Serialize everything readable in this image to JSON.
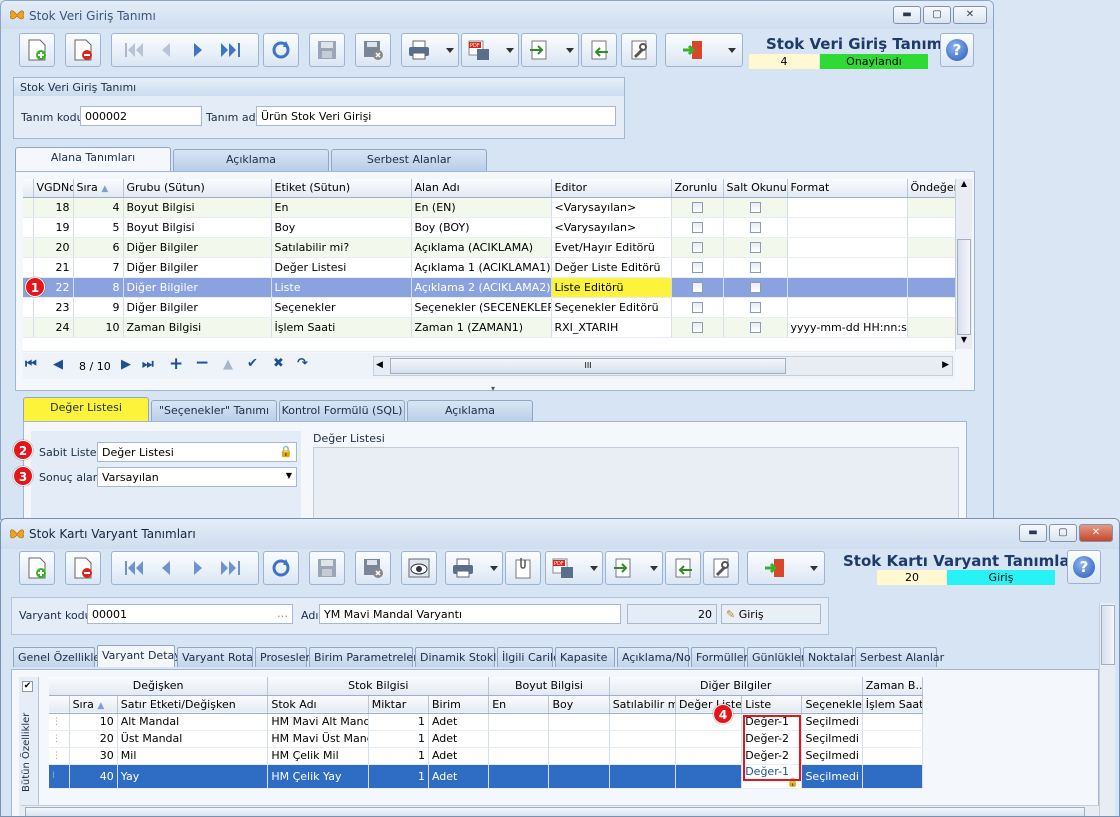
{
  "colors": {
    "accent": "#1d3a6a",
    "status_green": "#2edb32",
    "status_cyan": "#27f2f6",
    "highlight_yellow": "#fdf33a",
    "badge_red": "#e2161b"
  },
  "win1": {
    "title": "Stok Veri Giriş Tanımı",
    "heading": "Stok Veri Giriş Tanımı",
    "status_count": "4",
    "status_label": "Onaylandı",
    "group_title": "Stok Veri Giriş Tanımı",
    "code_label": "Tanım kodu",
    "code_value": "000002",
    "name_label": "Tanım adı",
    "name_value": "Ürün Stok Veri Girişi",
    "tabs": [
      "Alana Tanımları",
      "Açıklama",
      "Serbest Alanlar"
    ],
    "columns": [
      "VGDNo",
      "Sıra",
      "Grubu (Sütun)",
      "Etiket (Sütun)",
      "Alan Adı",
      "Editor",
      "Zorunlu",
      "Salt Okunur",
      "Format",
      "Öndeğer"
    ],
    "rows": [
      {
        "no": "18",
        "sira": "4",
        "grup": "Boyut Bilgisi",
        "etiket": "En",
        "alan": "En (EN)",
        "editor": "<Varysayılan>",
        "format": ""
      },
      {
        "no": "19",
        "sira": "5",
        "grup": "Boyut Bilgisi",
        "etiket": "Boy",
        "alan": "Boy (BOY)",
        "editor": "<Varysayılan>",
        "format": ""
      },
      {
        "no": "20",
        "sira": "6",
        "grup": "Diğer Bilgiler",
        "etiket": "Satılabilir mi?",
        "alan": "Açıklama (ACIKLAMA)",
        "editor": "Evet/Hayır Editörü",
        "format": ""
      },
      {
        "no": "21",
        "sira": "7",
        "grup": "Diğer Bilgiler",
        "etiket": "Değer Listesi",
        "alan": "Açıklama 1 (ACIKLAMA1)",
        "editor": "Değer Liste Editörü",
        "format": ""
      },
      {
        "no": "22",
        "sira": "8",
        "grup": "Diğer Bilgiler",
        "etiket": "Liste",
        "alan": "Açıklama 2 (ACIKLAMA2)",
        "editor": "Liste Editörü",
        "format": ""
      },
      {
        "no": "23",
        "sira": "9",
        "grup": "Diğer Bilgiler",
        "etiket": "Seçenekler",
        "alan": "Seçenekler (SECENEKLER)",
        "editor": "Seçenekler Editörü",
        "format": ""
      },
      {
        "no": "24",
        "sira": "10",
        "grup": "Zaman Bilgisi",
        "etiket": "İşlem Saati",
        "alan": "Zaman 1 (ZAMAN1)",
        "editor": "RXI_XTARIH",
        "format": "yyyy-mm-dd HH:nn:ss"
      }
    ],
    "nav_position": "8 / 10",
    "subtabs": [
      "Değer Listesi",
      "\"Seçenekler\" Tanımı",
      "Kontrol Formülü (SQL)",
      "Açıklama"
    ],
    "sabit_label": "Sabit Liste",
    "sabit_value": "Değer Listesi",
    "sonuc_label": "Sonuç alanı",
    "sonuc_value": "Varsayılan",
    "deger_listesi_label": "Değer Listesi",
    "badges": [
      "1",
      "2",
      "3"
    ]
  },
  "win2": {
    "title": "Stok Kartı Varyant Tanımları",
    "heading": "Stok Kartı Varyant Tanımları",
    "status_count": "20",
    "status_label": "Giriş",
    "code_label": "Varyant kodu",
    "code_value": "00001",
    "name_label": "Adı",
    "name_value": "YM Mavi Mandal Varyantı",
    "count_value": "20",
    "mode_value": "Giriş",
    "tabs": [
      "Genel Özellikler",
      "Varyant Detayı",
      "Varyant Rota",
      "Prosesler",
      "Birim Parametreleri",
      "Dinamik Stoklar",
      "İlgili Cariler",
      "Kapasite",
      "Açıklama/Not",
      "Formüller",
      "Günlükler",
      "Noktalar",
      "Serbest Alanlar"
    ],
    "band_headers": [
      "Değişken",
      "Stok Bilgisi",
      "Boyut Bilgisi",
      "Diğer Bilgiler",
      "Zaman B..."
    ],
    "columns": [
      "Sıra",
      "Satır Etketi/Değişken",
      "Stok Adı",
      "Miktar",
      "Birim",
      "En",
      "Boy",
      "Satılabilir mi?",
      "Değer Listesi",
      "Liste",
      "Seçenekler",
      "İşlem Saati"
    ],
    "side_label": "Bütün Özellikler",
    "rows": [
      {
        "sira": "10",
        "etiket": "Alt Mandal",
        "stok": "HM Mavi Alt Mandal",
        "miktar": "1",
        "birim": "Adet",
        "liste": "Değer-1",
        "secenek": "Seçilmedi"
      },
      {
        "sira": "20",
        "etiket": "Üst Mandal",
        "stok": "HM Mavi Üst Mandal",
        "miktar": "1",
        "birim": "Adet",
        "liste": "Değer-2",
        "secenek": "Seçilmedi"
      },
      {
        "sira": "30",
        "etiket": "Mil",
        "stok": "HM Çelik Mil",
        "miktar": "1",
        "birim": "Adet",
        "liste": "Değer-2",
        "secenek": "Seçilmedi"
      },
      {
        "sira": "40",
        "etiket": "Yay",
        "stok": "HM Çelik Yay",
        "miktar": "1",
        "birim": "Adet",
        "liste": "Değer-1",
        "secenek": "Seçilmedi"
      }
    ],
    "badge": "4"
  }
}
